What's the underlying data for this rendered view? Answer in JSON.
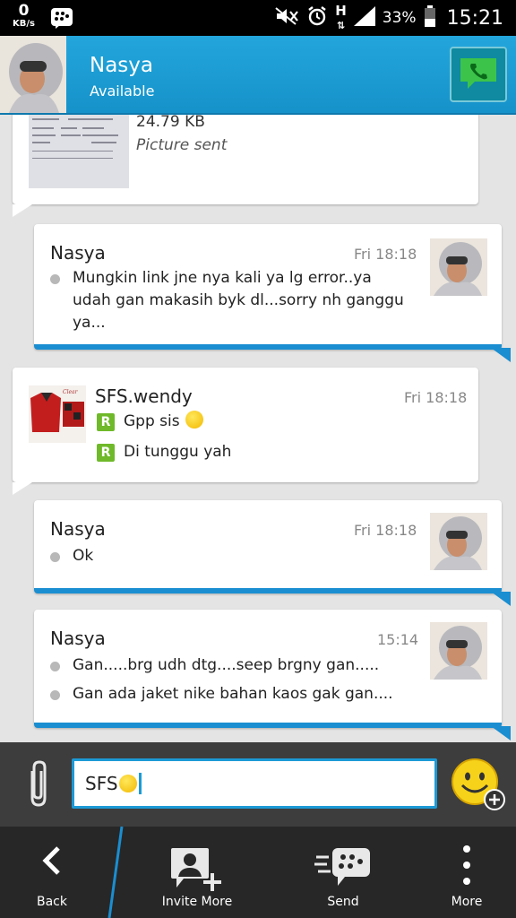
{
  "status_bar": {
    "net_speed_value": "0",
    "net_speed_unit": "KB/s",
    "network_type": "H",
    "battery_percent": "33%",
    "time": "15:21"
  },
  "header": {
    "contact_name": "Nasya",
    "contact_status": "Available"
  },
  "messages": [
    {
      "direction": "outgoing",
      "file_size": "24.79 KB",
      "status": "Picture sent"
    },
    {
      "direction": "incoming",
      "sender": "Nasya",
      "time": "Fri 18:18",
      "lines": [
        "Mungkin link jne nya kali ya lg error..ya",
        "udah gan makasih byk dl...sorry nh ganggu",
        "ya..."
      ]
    },
    {
      "direction": "outgoing",
      "sender": "SFS.wendy",
      "time": "Fri 18:18",
      "lines": [
        "Gpp sis",
        "Di tunggu yah"
      ],
      "read_badge": "R"
    },
    {
      "direction": "incoming",
      "sender": "Nasya",
      "time": "Fri 18:18",
      "lines": [
        "Ok"
      ]
    },
    {
      "direction": "incoming",
      "sender": "Nasya",
      "time": "15:14",
      "lines": [
        "Gan.....brg udh dtg....seep brgny gan.....",
        "Gan ada jaket nike bahan kaos gak gan...."
      ]
    }
  ],
  "composer": {
    "input_value": "SFS"
  },
  "bottom_bar": {
    "back_label": "Back",
    "invite_label": "Invite More",
    "send_label": "Send",
    "more_label": "More"
  },
  "colors": {
    "accent": "#1a8ed1",
    "header": "#1e9fd7",
    "read_badge": "#6fb92a"
  }
}
